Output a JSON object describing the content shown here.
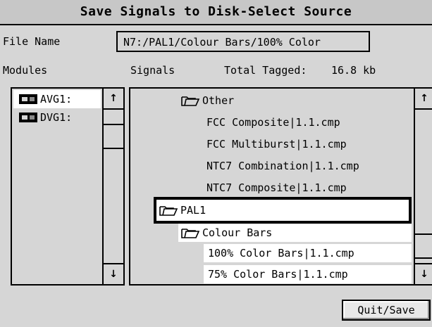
{
  "window": {
    "title": "Save Signals to Disk-Select Source"
  },
  "file_name": {
    "label": "File Name",
    "value": "N7:/PAL1/Colour Bars/100% Color"
  },
  "headers": {
    "modules": "Modules",
    "signals": "Signals",
    "total_tagged_label": "Total Tagged:",
    "total_tagged_value": "16.8 kb"
  },
  "modules": {
    "items": [
      {
        "label": "AVG1:",
        "icon": "module-card-icon",
        "selected": true
      },
      {
        "label": "DVG1:",
        "icon": "module-card-icon",
        "selected": false
      }
    ]
  },
  "signals": {
    "items": [
      {
        "label": "Other",
        "icon": "folder-open-icon"
      },
      {
        "label": "FCC  Composite|1.1.cmp"
      },
      {
        "label": "FCC  Multiburst|1.1.cmp"
      },
      {
        "label": "NTC7  Combination|1.1.cmp"
      },
      {
        "label": "NTC7  Composite|1.1.cmp"
      },
      {
        "label": "PAL1",
        "icon": "folder-open-icon",
        "focused": true
      },
      {
        "label": "Colour Bars",
        "icon": "folder-open-icon"
      },
      {
        "label": "100% Color  Bars|1.1.cmp"
      },
      {
        "label": "75% Color  Bars|1.1.cmp"
      }
    ]
  },
  "icons": {
    "scroll_up": "▲",
    "scroll_down": "▼",
    "up_arrow_glyph": "↑",
    "down_arrow_glyph": "↓"
  },
  "actions": {
    "quit_save_label": "Quit/Save"
  },
  "colors": {
    "background": "#d6d6d6",
    "selection": "#ffffff",
    "border": "#000000"
  }
}
